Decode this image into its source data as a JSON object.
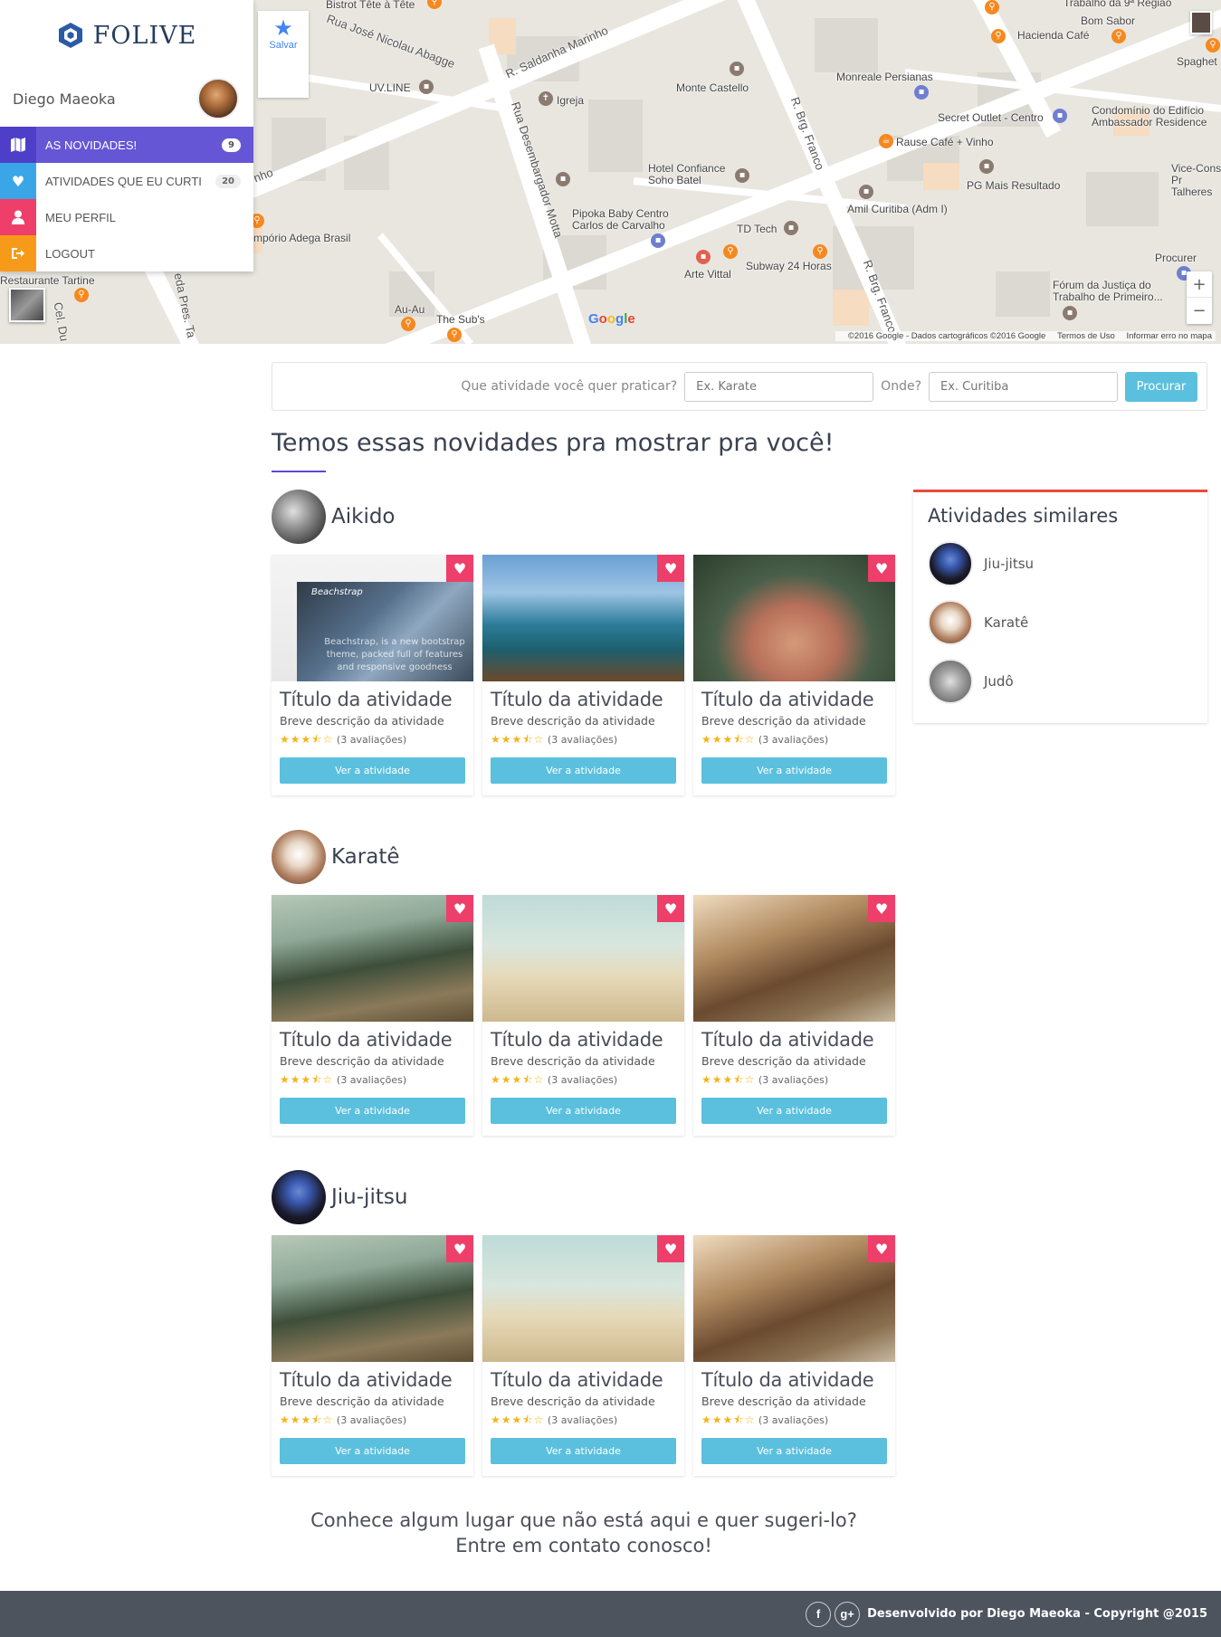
{
  "map": {
    "save_label": "Salvar",
    "zoom_in": "+",
    "zoom_out": "−",
    "google": [
      "G",
      "o",
      "o",
      "g",
      "l",
      "e"
    ],
    "attribution": "©2016 Google - Dados cartográficos ©2016 Google",
    "terms": "Termos de Uso",
    "report": "Informar erro no mapa",
    "labels": {
      "bistrot": "Bistrot Tête à Tête",
      "rua_jose": "Rua José Nicolau Abagge",
      "saldanha": "R. Saldanha Marinho",
      "uvline": "UV.LINE",
      "igreja": "Igreja",
      "monte_castello": "Monte Castello",
      "monreale": "Monreale Persianas",
      "trabalho9": "Trabalho da 9ª Região",
      "bom_sabor": "Bom Sabor",
      "hacienda": "Hacienda Café",
      "spaghetti": "Spaghet",
      "secret_outlet": "Secret Outlet - Centro",
      "condominio": "Condomínio do Edifício Ambassador Residence",
      "rause": "Rause Café + Vinho",
      "desembargador": "Rua Desembargador Motta",
      "brg_franco": "R. Brg. Franco",
      "brg_franco2": "R. Brg. Franco",
      "hotel": "Hotel Confiance Soho Batel",
      "pg_mais": "PG Mais Resultado",
      "vice_cons": "Vice-Cons Pr Talheres",
      "amil": "Amil Curitiba (Adm I)",
      "pipoka": "Pipoka Baby Centro Carlos de Carvalho",
      "td_tech": "TD Tech",
      "emporio": "mpório Adega Brasil",
      "restaurante": "Restaurante Tartine",
      "arte_vittal": "Arte Vittal",
      "subway": "Subway 24 Horas",
      "procurer": "Procurer",
      "forum": "Fórum da Justiça do Trabalho de Primeiro...",
      "au_au": "Au-Au",
      "the_subs": "The Sub's",
      "cel_du": "Cel. Du",
      "pres_ta": "eda Pres. Ta",
      "nho": "nho"
    }
  },
  "brand": {
    "name": "FOLIVE",
    "color": "#263c5c"
  },
  "user": {
    "name": "Diego Maeoka"
  },
  "nav": {
    "items": [
      {
        "label": "AS NOVIDADES!",
        "badge": "9",
        "icon": "map-icon"
      },
      {
        "label": "ATIVIDADES QUE EU CURTI",
        "badge": "20",
        "icon": "heart-icon"
      },
      {
        "label": "MEU PERFIL",
        "badge": "",
        "icon": "user-icon"
      },
      {
        "label": "LOGOUT",
        "badge": "",
        "icon": "sign-out-icon"
      }
    ]
  },
  "search": {
    "question": "Que atividade você quer praticar?",
    "activity_placeholder": "Ex. Karate",
    "where_label": "Onde?",
    "where_placeholder": "Ex. Curitiba",
    "button": "Procurar"
  },
  "page_title": "Temos essas novidades pra mostrar pra você!",
  "sections": [
    {
      "title": "Aikido",
      "cards": [
        {
          "title": "Título da atividade",
          "desc": "Breve descrição da atividade",
          "rating": 3.5,
          "reviews": "(3 avaliações)",
          "button": "Ver a atividade",
          "image": "img-site",
          "site_name": "Beachstrap",
          "site_text": "Beachstrap, is a new bootstrap theme, packed full of features and responsive goodness"
        },
        {
          "title": "Título da atividade",
          "desc": "Breve descrição da atividade",
          "rating": 3.5,
          "reviews": "(3 avaliações)",
          "button": "Ver a atividade",
          "image": "img-boat"
        },
        {
          "title": "Título da atividade",
          "desc": "Breve descrição da atividade",
          "rating": 3.5,
          "reviews": "(3 avaliações)",
          "button": "Ver a atividade",
          "image": "img-face"
        }
      ]
    },
    {
      "title": "Karatê",
      "cards": [
        {
          "title": "Título da atividade",
          "desc": "Breve descrição da atividade",
          "rating": 3.5,
          "reviews": "(3 avaliações)",
          "button": "Ver a atividade",
          "image": "img-lake"
        },
        {
          "title": "Título da atividade",
          "desc": "Breve descrição da atividade",
          "rating": 3.5,
          "reviews": "(3 avaliações)",
          "button": "Ver a atividade",
          "image": "img-beach"
        },
        {
          "title": "Título da atividade",
          "desc": "Breve descrição da atividade",
          "rating": 3.5,
          "reviews": "(3 avaliações)",
          "button": "Ver a atividade",
          "image": "img-forest"
        }
      ]
    },
    {
      "title": "Jiu-jitsu",
      "cards": [
        {
          "title": "Título da atividade",
          "desc": "Breve descrição da atividade",
          "rating": 3.5,
          "reviews": "(3 avaliações)",
          "button": "Ver a atividade",
          "image": "img-lake"
        },
        {
          "title": "Título da atividade",
          "desc": "Breve descrição da atividade",
          "rating": 3.5,
          "reviews": "(3 avaliações)",
          "button": "Ver a atividade",
          "image": "img-beach"
        },
        {
          "title": "Título da atividade",
          "desc": "Breve descrição da atividade",
          "rating": 3.5,
          "reviews": "(3 avaliações)",
          "button": "Ver a atividade",
          "image": "img-forest"
        }
      ]
    }
  ],
  "similar": {
    "title": "Atividades similares",
    "items": [
      {
        "name": "Jiu-jitsu"
      },
      {
        "name": "Karatê"
      },
      {
        "name": "Judô"
      }
    ]
  },
  "contact": {
    "line1": "Conhece algum lugar que não está aqui e quer sugeri-lo?",
    "line2": "Entre em contato conosco!"
  },
  "footer": {
    "facebook": "f",
    "google_plus": "g+",
    "text": "Desenvolvido por Diego Maeoka - Copyright @2015"
  },
  "colors": {
    "accent": "#6556d6",
    "info_button": "#5bc0de",
    "favorite": "#ee3e6a",
    "similar_border": "#e74c3c",
    "footer_bg": "#4e545e"
  }
}
